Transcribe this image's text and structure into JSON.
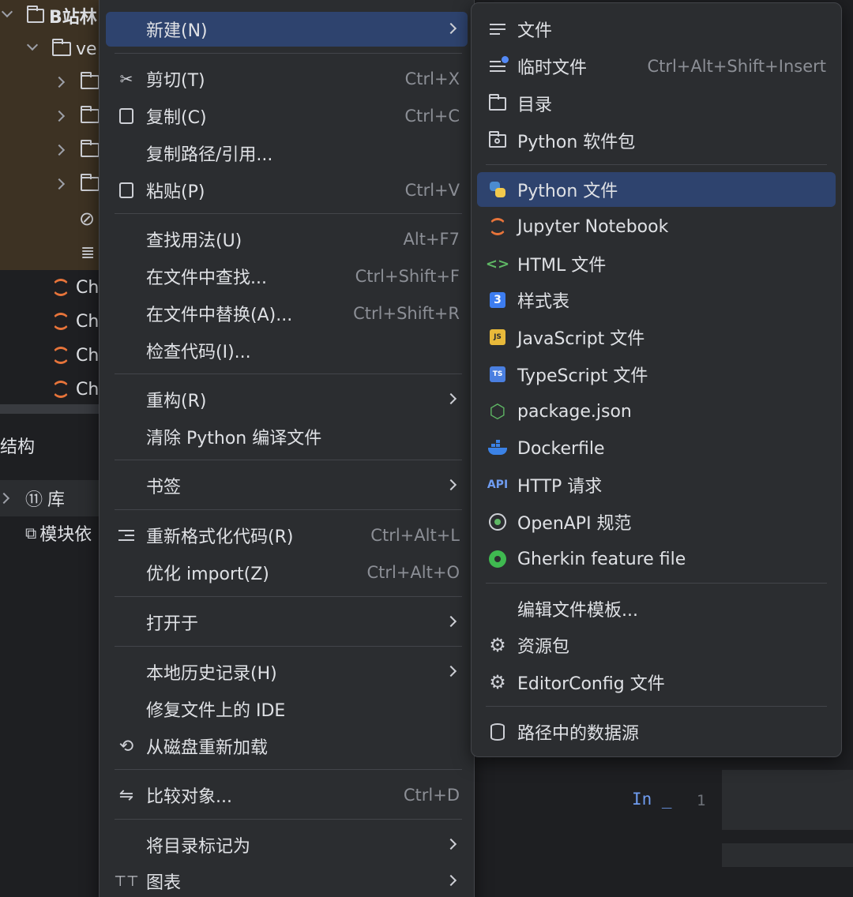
{
  "project_tree": {
    "root_label": "B站林",
    "folder_label": "ve",
    "file_labels": [
      "Ch",
      "Ch",
      "Ch",
      "Ch"
    ],
    "structure_title": "结构",
    "lib_label": "库",
    "module_label": "模块依"
  },
  "main_menu": {
    "items": [
      {
        "label": "新建(N)",
        "shortcut": "",
        "icon": "",
        "submenu": true
      },
      {
        "label": "剪切(T)",
        "shortcut": "Ctrl+X",
        "icon": "scissors-icon"
      },
      {
        "label": "复制(C)",
        "shortcut": "Ctrl+C",
        "icon": "copy-icon"
      },
      {
        "label": "复制路径/引用...",
        "shortcut": "",
        "icon": ""
      },
      {
        "label": "粘贴(P)",
        "shortcut": "Ctrl+V",
        "icon": "paste-icon"
      },
      {
        "label": "查找用法(U)",
        "shortcut": "Alt+F7",
        "icon": ""
      },
      {
        "label": "在文件中查找...",
        "shortcut": "Ctrl+Shift+F",
        "icon": ""
      },
      {
        "label": "在文件中替换(A)...",
        "shortcut": "Ctrl+Shift+R",
        "icon": ""
      },
      {
        "label": "检查代码(I)...",
        "shortcut": "",
        "icon": ""
      },
      {
        "label": "重构(R)",
        "shortcut": "",
        "icon": "",
        "submenu": true
      },
      {
        "label": "清除 Python 编译文件",
        "shortcut": "",
        "icon": ""
      },
      {
        "label": "书签",
        "shortcut": "",
        "icon": "",
        "submenu": true
      },
      {
        "label": "重新格式化代码(R)",
        "shortcut": "Ctrl+Alt+L",
        "icon": "reformat-icon"
      },
      {
        "label": "优化 import(Z)",
        "shortcut": "Ctrl+Alt+O",
        "icon": ""
      },
      {
        "label": "打开于",
        "shortcut": "",
        "icon": "",
        "submenu": true
      },
      {
        "label": "本地历史记录(H)",
        "shortcut": "",
        "icon": "",
        "submenu": true
      },
      {
        "label": "修复文件上的 IDE",
        "shortcut": "",
        "icon": ""
      },
      {
        "label": "从磁盘重新加载",
        "shortcut": "",
        "icon": "reload-icon"
      },
      {
        "label": "比较对象...",
        "shortcut": "Ctrl+D",
        "icon": "compare-icon"
      },
      {
        "label": "将目录标记为",
        "shortcut": "",
        "icon": "",
        "submenu": true
      },
      {
        "label": "图表",
        "shortcut": "",
        "icon": "diagram-icon",
        "submenu": true
      }
    ]
  },
  "new_submenu": {
    "items": [
      {
        "label": "文件",
        "shortcut": "",
        "icon": "file-icon"
      },
      {
        "label": "临时文件",
        "shortcut": "Ctrl+Alt+Shift+Insert",
        "icon": "scratch-file-icon"
      },
      {
        "label": "目录",
        "shortcut": "",
        "icon": "folder-icon"
      },
      {
        "label": "Python 软件包",
        "shortcut": "",
        "icon": "python-package-icon"
      },
      {
        "label": "Python 文件",
        "shortcut": "",
        "icon": "python-icon",
        "selected": true
      },
      {
        "label": "Jupyter Notebook",
        "shortcut": "",
        "icon": "jupyter-icon"
      },
      {
        "label": "HTML 文件",
        "shortcut": "",
        "icon": "html-icon"
      },
      {
        "label": "样式表",
        "shortcut": "",
        "icon": "css-icon"
      },
      {
        "label": "JavaScript 文件",
        "shortcut": "",
        "icon": "javascript-icon"
      },
      {
        "label": "TypeScript 文件",
        "shortcut": "",
        "icon": "typescript-icon"
      },
      {
        "label": "package.json",
        "shortcut": "",
        "icon": "nodejs-icon"
      },
      {
        "label": "Dockerfile",
        "shortcut": "",
        "icon": "docker-icon"
      },
      {
        "label": "HTTP 请求",
        "shortcut": "",
        "icon": "api-icon"
      },
      {
        "label": "OpenAPI 规范",
        "shortcut": "",
        "icon": "openapi-icon"
      },
      {
        "label": "Gherkin feature file",
        "shortcut": "",
        "icon": "cucumber-icon"
      },
      {
        "label": "编辑文件模板...",
        "shortcut": "",
        "icon": ""
      },
      {
        "label": "资源包",
        "shortcut": "",
        "icon": "gear-icon"
      },
      {
        "label": "EditorConfig 文件",
        "shortcut": "",
        "icon": "gear-icon"
      },
      {
        "label": "路径中的数据源",
        "shortcut": "",
        "icon": "database-icon"
      }
    ]
  },
  "editor": {
    "cell_prompt": "In _",
    "line_number": "1"
  },
  "colors": {
    "menu_bg": "#2b2d30",
    "selected_bg": "#2e436e",
    "text": "#dfe1e5",
    "shortcut": "#8c8f96",
    "tree_highlight": "#3d3223"
  }
}
